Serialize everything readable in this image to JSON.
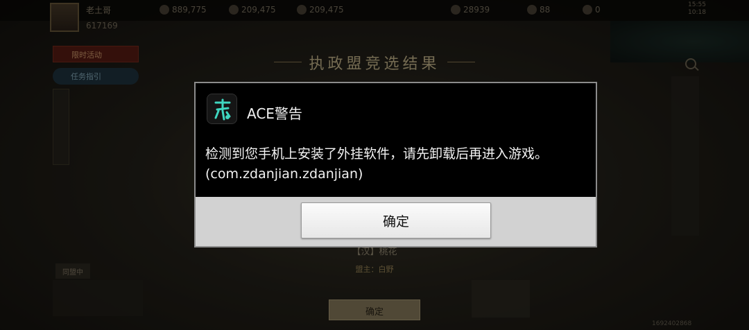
{
  "game": {
    "player_name": "老土哥",
    "player_power": "617169",
    "resources": [
      {
        "icon": "grain-icon",
        "value": "889,775"
      },
      {
        "icon": "wood-icon",
        "value": "209,475"
      },
      {
        "icon": "stone-icon",
        "value": "209,475"
      },
      {
        "icon": "coin-icon",
        "value": "28939"
      },
      {
        "icon": "jade-icon",
        "value": "88"
      },
      {
        "icon": "token-icon",
        "value": "0"
      }
    ],
    "clock": "15:55\n10:18",
    "page_title": "执政盟竞选结果",
    "event_banner": "限时活动",
    "quest_pill": "任务指引",
    "side_tab": "同盟中",
    "alliance_name": "【汉】桃花",
    "alliance_leader": "盟主：白野",
    "confirm_label": "确定",
    "user_id": "1692402868"
  },
  "dialog": {
    "title": "ACE警告",
    "icon": "ace-app-icon",
    "message": "检测到您手机上安装了外挂软件，请先卸载后再进入游戏。(com.zdanjian.zdanjian)",
    "ok_label": "确定"
  },
  "colors": {
    "dialog_bg": "#000000",
    "dialog_footer": "#d2d2d2",
    "title_gold": "#c9b98e"
  }
}
